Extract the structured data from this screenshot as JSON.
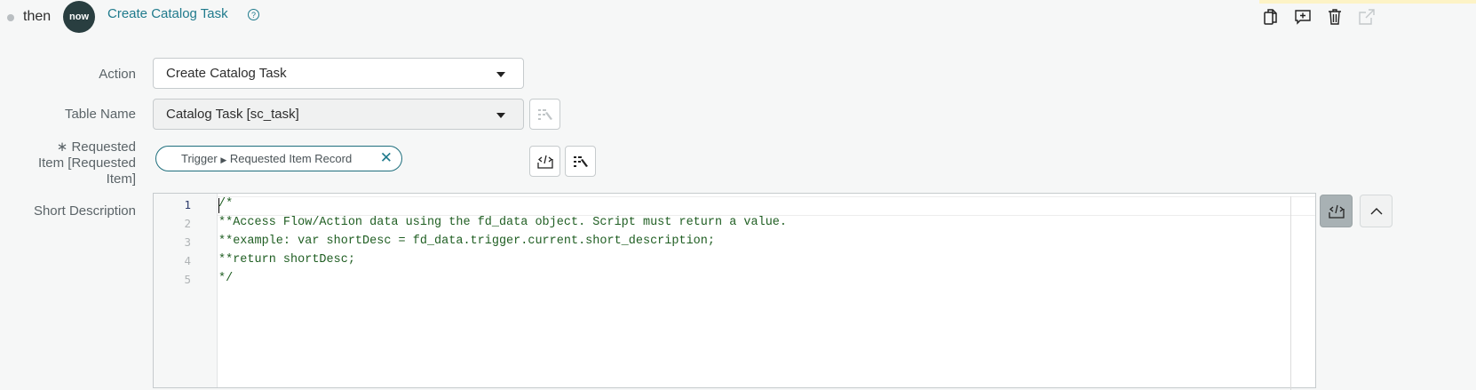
{
  "header": {
    "connector": "then",
    "logo_text": "now",
    "title": "Create Catalog Task",
    "help": "?"
  },
  "toolbar": [
    "copy-icon",
    "add-comment-icon",
    "delete-icon",
    "open-external-icon"
  ],
  "form": {
    "action": {
      "label": "Action",
      "value": "Create Catalog Task"
    },
    "table_name": {
      "label": "Table Name",
      "value": "Catalog Task [sc_task]"
    },
    "requested_item": {
      "required_mark": "∗",
      "label_lines": [
        "Requested",
        "Item [Requested",
        "Item]"
      ],
      "pill": {
        "source": "Trigger",
        "field": "Requested Item Record"
      }
    },
    "short_description": {
      "label": "Short Description"
    }
  },
  "editor": {
    "lines": [
      {
        "n": "1",
        "text": "/*"
      },
      {
        "n": "2",
        "text": "**Access Flow/Action data using the fd_data object. Script must return a value."
      },
      {
        "n": "3",
        "text": "**example: var shortDesc = fd_data.trigger.current.short_description;"
      },
      {
        "n": "4",
        "text": "**return shortDesc;"
      },
      {
        "n": "5",
        "text": "*/"
      }
    ]
  },
  "colors": {
    "accent": "#1f7a8c",
    "code": "#1f5e22",
    "logo_bg": "#293e40"
  }
}
